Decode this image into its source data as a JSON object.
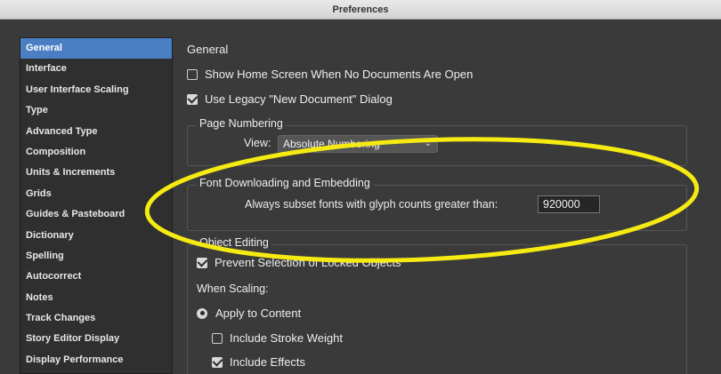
{
  "window": {
    "title": "Preferences"
  },
  "sidebar": {
    "items": [
      {
        "label": "General",
        "selected": true
      },
      {
        "label": "Interface"
      },
      {
        "label": "User Interface Scaling"
      },
      {
        "label": "Type"
      },
      {
        "label": "Advanced Type"
      },
      {
        "label": "Composition"
      },
      {
        "label": "Units & Increments"
      },
      {
        "label": "Grids"
      },
      {
        "label": "Guides & Pasteboard"
      },
      {
        "label": "Dictionary"
      },
      {
        "label": "Spelling"
      },
      {
        "label": "Autocorrect"
      },
      {
        "label": "Notes"
      },
      {
        "label": "Track Changes"
      },
      {
        "label": "Story Editor Display"
      },
      {
        "label": "Display Performance"
      }
    ]
  },
  "general": {
    "title": "General",
    "show_home_screen": {
      "label": "Show Home Screen When No Documents Are Open",
      "checked": false
    },
    "legacy_new_doc": {
      "label": "Use Legacy \"New Document\" Dialog",
      "checked": true
    },
    "page_numbering": {
      "legend": "Page Numbering",
      "view_label": "View:",
      "view_value": "Absolute Numbering"
    },
    "font_downloading": {
      "legend": "Font Downloading and Embedding",
      "subset_label": "Always subset fonts with glyph counts greater than:",
      "subset_value": "920000"
    },
    "object_editing": {
      "legend": "Object Editing",
      "prevent_locked": {
        "label": "Prevent Selection of Locked Objects",
        "checked": true
      },
      "when_scaling_label": "When Scaling:",
      "apply_to_content": {
        "label": "Apply to Content",
        "selected": true
      },
      "include_stroke": {
        "label": "Include Stroke Weight",
        "checked": false
      },
      "include_effects": {
        "label": "Include Effects",
        "checked": true
      }
    }
  },
  "colors": {
    "background": "#3a3a3a",
    "sidebar_selected": "#4b7fc4",
    "annotation_ellipse": "#f5ea12"
  }
}
